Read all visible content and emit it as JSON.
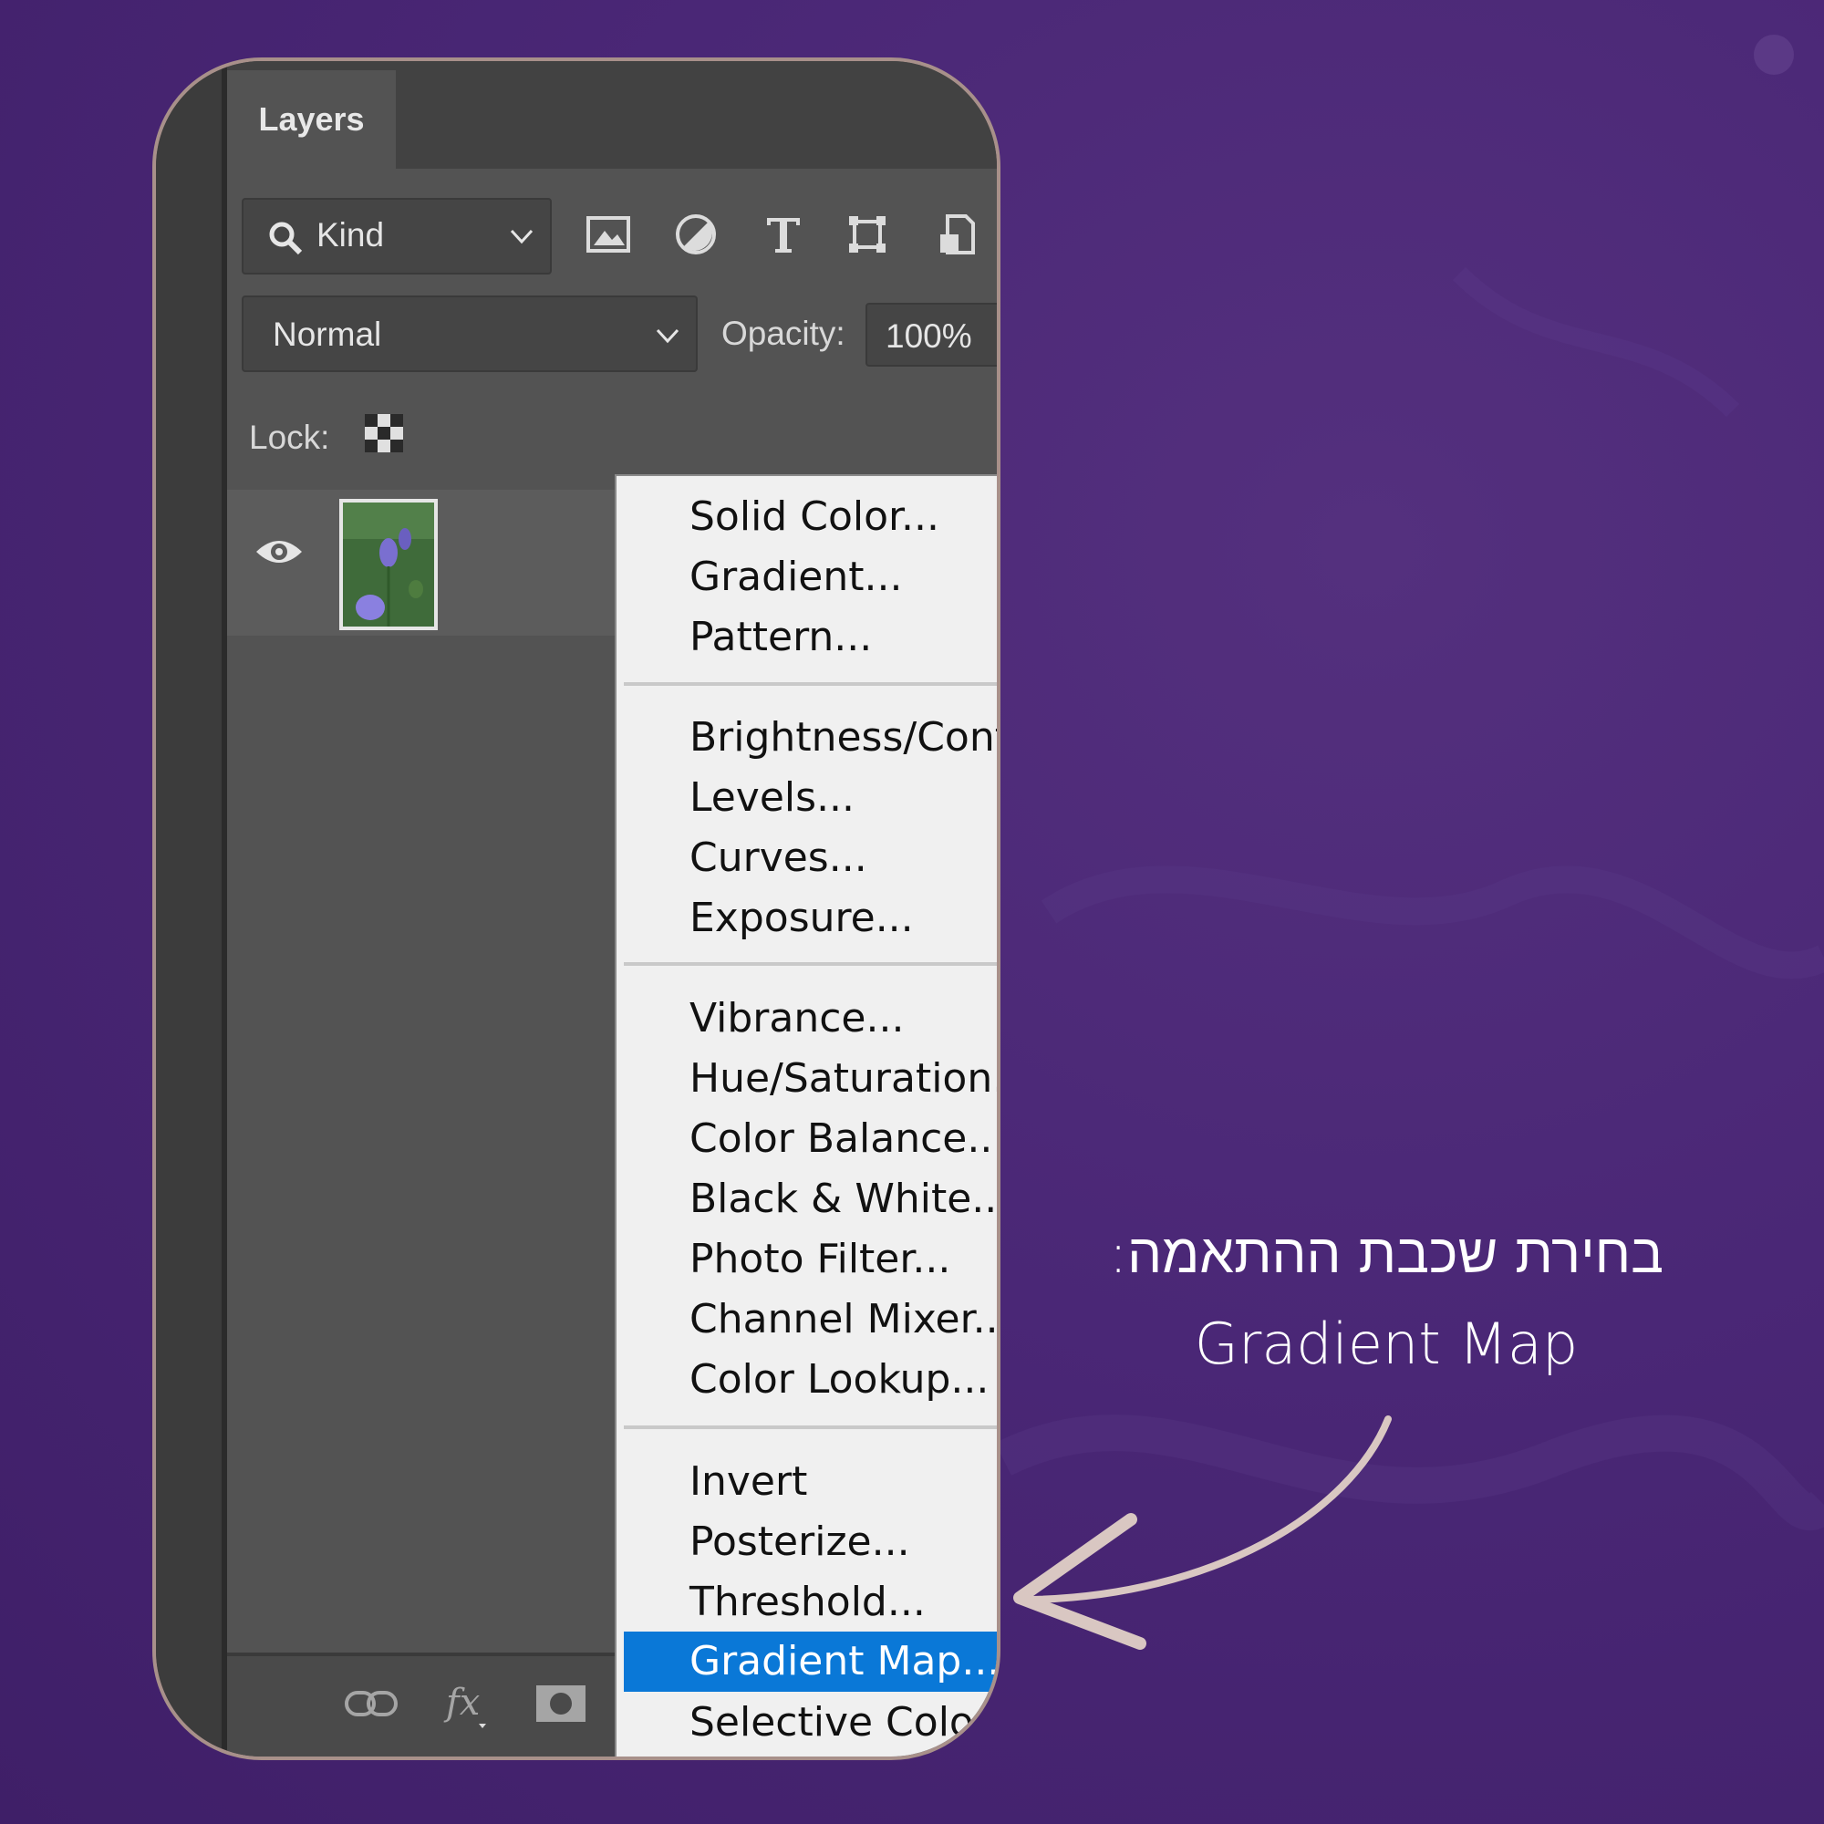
{
  "panel": {
    "tab_label": "Layers",
    "filter": {
      "value": "Kind",
      "icons": [
        "image-filter-icon",
        "adjustment-filter-icon",
        "type-filter-icon",
        "shape-filter-icon",
        "smart-object-filter-icon"
      ]
    },
    "blend_mode": "Normal",
    "opacity_label": "Opacity:",
    "opacity_value": "100%",
    "lock_label": "Lock:",
    "bottom_icons": [
      "link-layers-icon",
      "fx-icon",
      "layer-mask-icon",
      "adjustment-layer-icon",
      "group-folder-icon",
      "new-layer-icon",
      "trash-icon"
    ]
  },
  "menu": {
    "groups": [
      [
        "Solid Color...",
        "Gradient...",
        "Pattern..."
      ],
      [
        "Brightness/Contrast...",
        "Levels...",
        "Curves...",
        "Exposure..."
      ],
      [
        "Vibrance...",
        "Hue/Saturation...",
        "Color Balance...",
        "Black & White...",
        "Photo Filter...",
        "Channel Mixer...",
        "Color Lookup..."
      ],
      [
        "Invert",
        "Posterize...",
        "Threshold...",
        "Gradient Map...",
        "Selective Color..."
      ]
    ],
    "highlighted": "Gradient Map..."
  },
  "caption": {
    "line1": "בחירת שכבת ההתאמה:",
    "line2": "Gradient Map"
  },
  "colors": {
    "background": "#4a2776",
    "frame_border": "#a8908a",
    "highlight": "#0a78d7",
    "arrow": "#d9c7c2"
  }
}
